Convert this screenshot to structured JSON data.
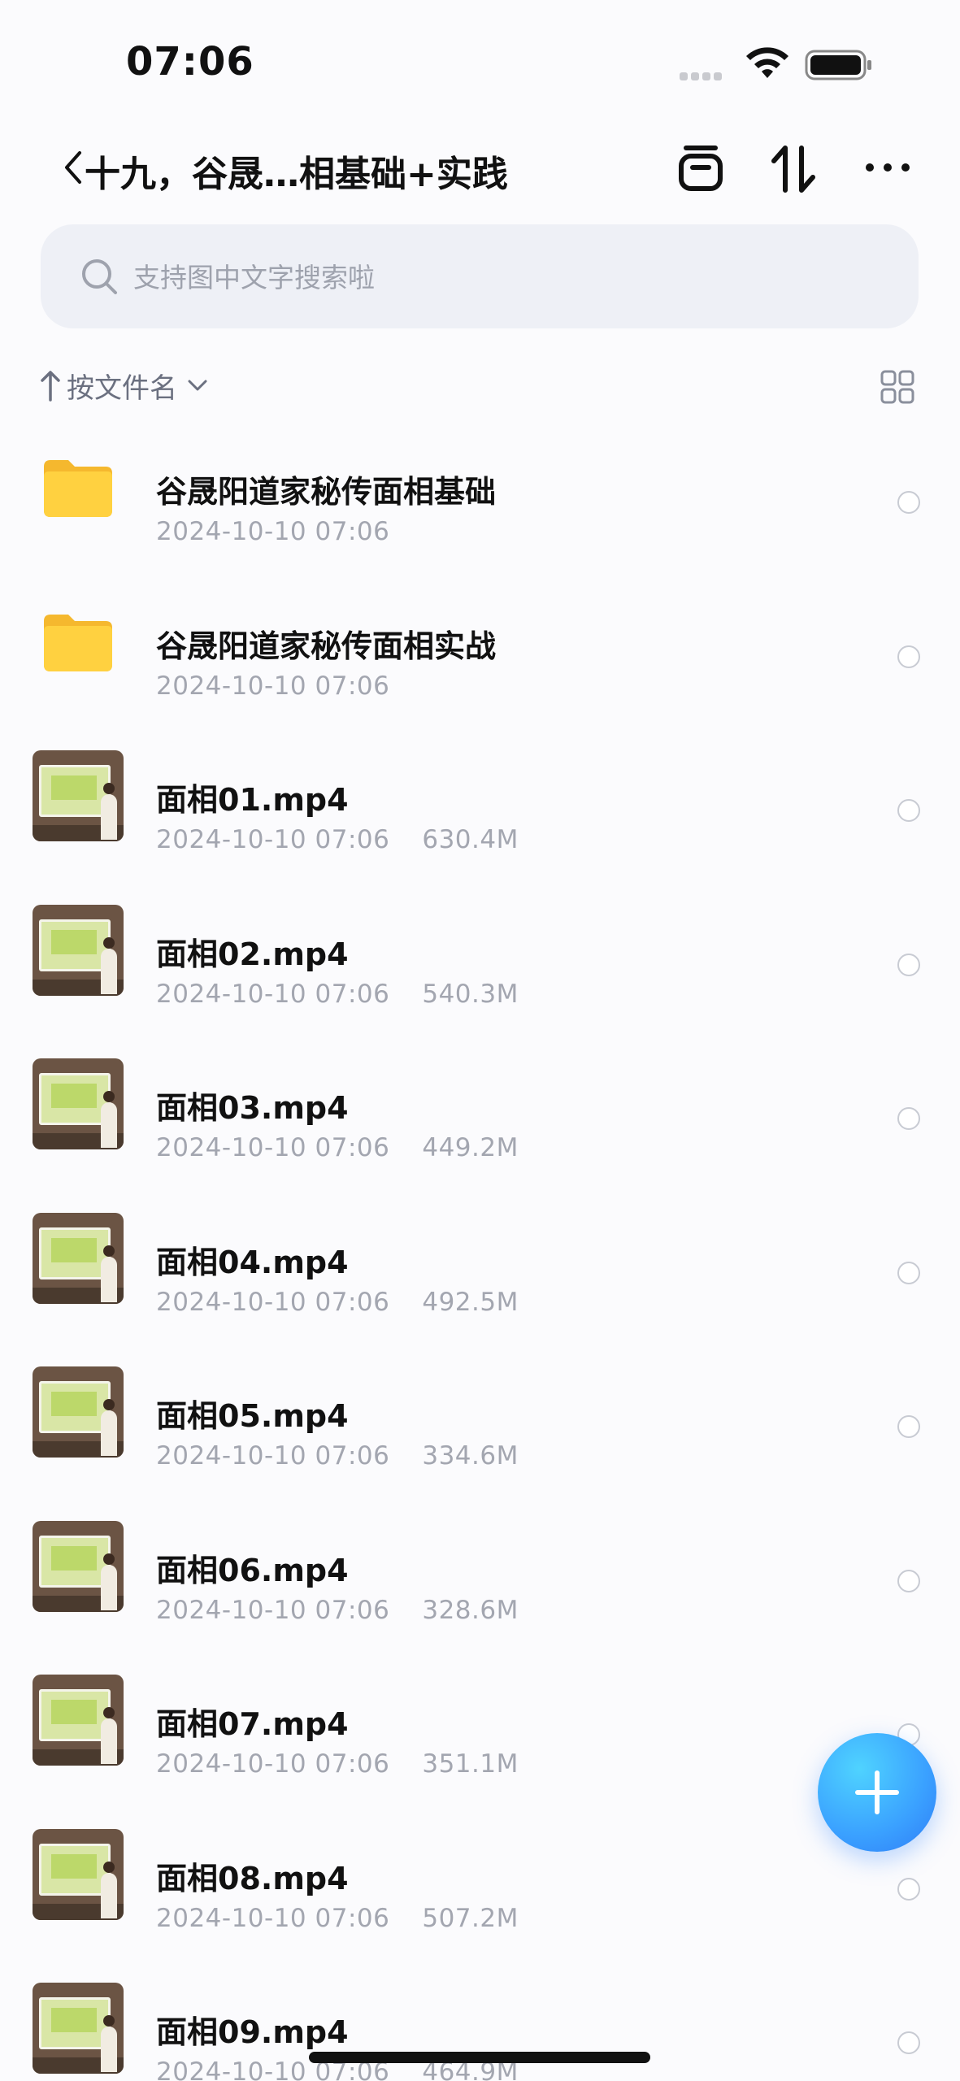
{
  "status_bar": {
    "time": "07:06",
    "icons": [
      "cellular-signal-icon",
      "wifi-icon",
      "battery-icon"
    ]
  },
  "nav": {
    "title": "十九，谷晟…相基础+实践",
    "icons": [
      "back-icon",
      "archive-icon",
      "sort-icon",
      "more-icon"
    ]
  },
  "search": {
    "placeholder": "支持图中文字搜索啦"
  },
  "sort": {
    "label": "按文件名"
  },
  "files": [
    {
      "name": "谷晟阳道家秘传面相基础",
      "date": "2024-10-10 07:06",
      "size": "",
      "type": "folder"
    },
    {
      "name": "谷晟阳道家秘传面相实战",
      "date": "2024-10-10 07:06",
      "size": "",
      "type": "folder"
    },
    {
      "name": "面相01.mp4",
      "date": "2024-10-10 07:06",
      "size": "630.4M",
      "type": "video"
    },
    {
      "name": "面相02.mp4",
      "date": "2024-10-10 07:06",
      "size": "540.3M",
      "type": "video"
    },
    {
      "name": "面相03.mp4",
      "date": "2024-10-10 07:06",
      "size": "449.2M",
      "type": "video"
    },
    {
      "name": "面相04.mp4",
      "date": "2024-10-10 07:06",
      "size": "492.5M",
      "type": "video"
    },
    {
      "name": "面相05.mp4",
      "date": "2024-10-10 07:06",
      "size": "334.6M",
      "type": "video"
    },
    {
      "name": "面相06.mp4",
      "date": "2024-10-10 07:06",
      "size": "328.6M",
      "type": "video"
    },
    {
      "name": "面相07.mp4",
      "date": "2024-10-10 07:06",
      "size": "351.1M",
      "type": "video"
    },
    {
      "name": "面相08.mp4",
      "date": "2024-10-10 07:06",
      "size": "507.2M",
      "type": "video"
    },
    {
      "name": "面相09.mp4",
      "date": "2024-10-10 07:06",
      "size": "464.9M",
      "type": "video"
    }
  ],
  "colors": {
    "accent": "#3aa0ff",
    "folder": "#ffcf3f",
    "meta_text": "#a3a6b0"
  }
}
